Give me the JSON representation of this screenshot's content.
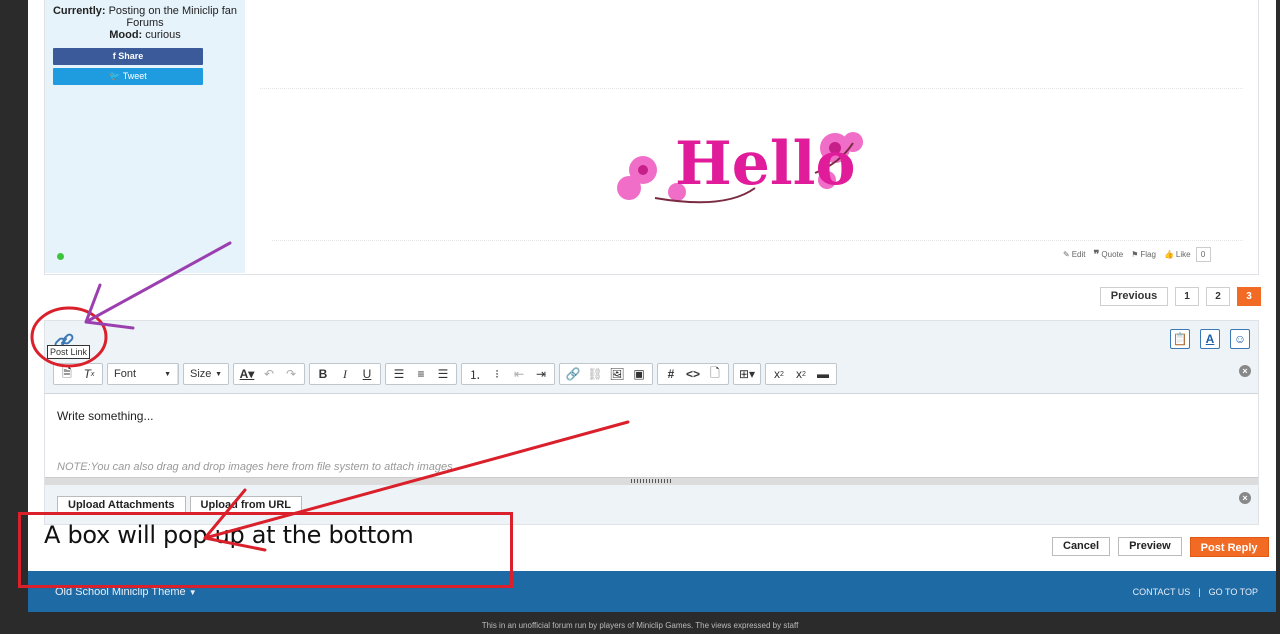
{
  "user": {
    "currently_label": "Currently:",
    "currently_value": "Posting on the Miniclip fan Forums",
    "mood_label": "Mood:",
    "mood_value": "curious",
    "share_label": "Share",
    "tweet_label": "Tweet"
  },
  "post": {
    "image_text": "Hello",
    "actions": {
      "edit": "Edit",
      "quote": "Quote",
      "flag": "Flag",
      "like": "Like",
      "like_count": "0"
    }
  },
  "pagination": {
    "previous": "Previous",
    "pages": [
      "1",
      "2",
      "3"
    ],
    "active": "3"
  },
  "editor": {
    "tooltip": "Post Link",
    "font_select": "Font",
    "size_select": "Size",
    "placeholder": "Write something...",
    "note": "NOTE:You can also drag and drop images here from file system to attach images.",
    "upload_attachments": "Upload Attachments",
    "upload_from_url": "Upload from URL"
  },
  "actions": {
    "cancel": "Cancel",
    "preview": "Preview",
    "post_reply": "Post Reply"
  },
  "footer": {
    "theme": "Old School Miniclip Theme",
    "contact": "CONTACT US",
    "separator": "|",
    "go_to_top": "GO TO TOP",
    "disclaimer": "This in an unofficial forum run by players of Miniclip Games. The views expressed by staff"
  },
  "annotation": {
    "text": "A box will pop up at the bottom"
  },
  "colors": {
    "accent_orange": "#f26b24",
    "footer_blue": "#1e6aa5",
    "annotation_red": "#d9202b",
    "annotation_purple": "#9b3fb0"
  }
}
